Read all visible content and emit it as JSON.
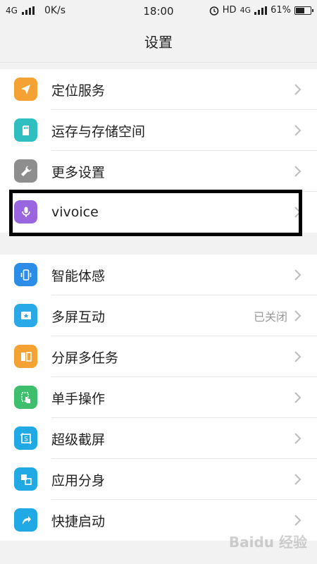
{
  "status_bar": {
    "network": "4G",
    "speed": "0K/s",
    "time": "18:00",
    "hd": "HD",
    "network_right": "4G",
    "battery_text": "61%",
    "battery_level": 0.61
  },
  "header": {
    "title": "设置"
  },
  "group1": {
    "items": [
      {
        "label": "定位服务",
        "icon": "location-icon",
        "color": "#f5a234"
      },
      {
        "label": "运存与存储空间",
        "icon": "sd-card-icon",
        "color": "#2fbfc0"
      },
      {
        "label": "更多设置",
        "icon": "wrench-icon",
        "color": "#8e8e8e"
      },
      {
        "label": "vivoice",
        "icon": "microphone-icon",
        "color": "#9a66e0"
      }
    ]
  },
  "group2": {
    "items": [
      {
        "label": "智能体感",
        "value": "",
        "icon": "phone-vibrate-icon",
        "color": "#2b8de8"
      },
      {
        "label": "多屏互动",
        "value": "已关闭",
        "icon": "screen-cast-icon",
        "color": "#2aa9e8"
      },
      {
        "label": "分屏多任务",
        "value": "",
        "icon": "split-screen-icon",
        "color": "#f5a234"
      },
      {
        "label": "单手操作",
        "value": "",
        "icon": "one-hand-icon",
        "color": "#3dbf6e"
      },
      {
        "label": "超级截屏",
        "value": "",
        "icon": "screenshot-icon",
        "color": "#21a9e6"
      },
      {
        "label": "应用分身",
        "value": "",
        "icon": "app-clone-icon",
        "color": "#21a9e6"
      },
      {
        "label": "快捷启动",
        "value": "",
        "icon": "quick-launch-icon",
        "color": "#21a9e6"
      }
    ]
  },
  "watermark": "Baidu 经验"
}
